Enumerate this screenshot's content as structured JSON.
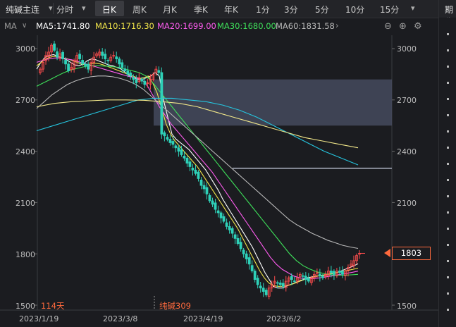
{
  "toolbar": {
    "title": "纯碱主连",
    "periods": [
      "分时",
      "日K",
      "周K",
      "月K",
      "季K",
      "年K",
      "1分",
      "3分",
      "5分",
      "10分",
      "15分"
    ],
    "active_period": "日K",
    "side_tab": "期货"
  },
  "ma": {
    "label": "MA",
    "ma5": "MA5:1741.80",
    "ma10": "MA10:1716.30",
    "ma20": "MA20:1699.00",
    "ma30": "MA30:1680.00",
    "ma60": "MA60:1831.58",
    "colors": {
      "ma5": "#ffffff",
      "ma10": "#f2e64a",
      "ma20": "#ff5cf0",
      "ma30": "#3ee05a",
      "ma60": "#b9b9b9",
      "long1": "#25c6e0",
      "long2": "#f2e88a"
    }
  },
  "y_ticks": [
    "3000",
    "2700",
    "2400",
    "2100",
    "1800",
    "1500"
  ],
  "x_ticks": [
    "2023/1/19",
    "2023/3/8",
    "2023/4/19",
    "2023/6/2"
  ],
  "current_price": "1803",
  "days_label": "114天",
  "contract_label": "纯碱309",
  "colors": {
    "up": "#ff4d4d",
    "down": "#2ed1b8",
    "accent": "#ff6a3d",
    "zone": "#4b5066"
  },
  "chart_data": {
    "type": "candlestick",
    "ylim": [
      1500,
      3000
    ],
    "y_ticks": [
      3000,
      2700,
      2400,
      2100,
      1800,
      1500
    ],
    "x_ticks": [
      "2023/1/19",
      "2023/3/8",
      "2023/4/19",
      "2023/6/2"
    ],
    "last_price": 1803,
    "highlight_zone": {
      "from": 2550,
      "to": 2820
    },
    "dashed_level": 2300,
    "ma": {
      "ma5": 1741.8,
      "ma10": 1716.3,
      "ma20": 1699.0,
      "ma30": 1680.0,
      "ma60": 1831.58
    },
    "candles_close": [
      2880,
      2920,
      2960,
      2980,
      3020,
      2990,
      2950,
      2970,
      2940,
      2910,
      2870,
      2890,
      2930,
      2960,
      2940,
      2910,
      2900,
      2880,
      2920,
      2950,
      2970,
      2980,
      2960,
      2940,
      2930,
      2950,
      2960,
      2940,
      2910,
      2890,
      2870,
      2850,
      2840,
      2820,
      2800,
      2830,
      2810,
      2790,
      2800,
      2820,
      2850,
      2880,
      2860,
      2500,
      2490,
      2470,
      2450,
      2440,
      2420,
      2400,
      2380,
      2360,
      2330,
      2310,
      2290,
      2270,
      2240,
      2200,
      2180,
      2150,
      2110,
      2090,
      2060,
      2040,
      2010,
      1990,
      1960,
      1940,
      1920,
      1890,
      1860,
      1830,
      1800,
      1770,
      1740,
      1700,
      1650,
      1620,
      1600,
      1580,
      1560,
      1600,
      1620,
      1640,
      1630,
      1620,
      1610,
      1640,
      1660,
      1650,
      1640,
      1660,
      1680,
      1670,
      1650,
      1640,
      1660,
      1680,
      1690,
      1670,
      1660,
      1680,
      1700,
      1690,
      1680,
      1700,
      1690,
      1680,
      1700,
      1720,
      1740,
      1760,
      1790,
      1803
    ],
    "series": [
      {
        "name": "MA5",
        "values": [
          2880,
          2920,
          2950,
          2960,
          2965,
          2955,
          2945,
          2935,
          2920,
          2905,
          2900,
          2910,
          2930,
          2940,
          2935,
          2925,
          2915,
          2905,
          2900,
          2890,
          2880,
          2860,
          2840,
          2830,
          2820,
          2820,
          2830,
          2840,
          2860,
          2840,
          2700,
          2600,
          2500,
          2470,
          2450,
          2430,
          2410,
          2380,
          2350,
          2320,
          2290,
          2250,
          2210,
          2170,
          2120,
          2080,
          2040,
          2000,
          1960,
          1920,
          1880,
          1840,
          1790,
          1740,
          1690,
          1650,
          1610,
          1600,
          1600,
          1610,
          1620,
          1630,
          1640,
          1650,
          1660,
          1665,
          1670,
          1672,
          1675,
          1680,
          1685,
          1690,
          1700,
          1710,
          1720,
          1730,
          1741.8
        ]
      },
      {
        "name": "MA10",
        "values": [
          2900,
          2920,
          2940,
          2950,
          2955,
          2950,
          2945,
          2940,
          2930,
          2920,
          2910,
          2905,
          2910,
          2915,
          2912,
          2905,
          2895,
          2885,
          2875,
          2865,
          2855,
          2845,
          2835,
          2825,
          2830,
          2840,
          2800,
          2740,
          2650,
          2560,
          2500,
          2460,
          2430,
          2400,
          2370,
          2340,
          2310,
          2270,
          2230,
          2190,
          2150,
          2110,
          2070,
          2030,
          1990,
          1950,
          1900,
          1850,
          1800,
          1750,
          1700,
          1660,
          1630,
          1615,
          1610,
          1610,
          1615,
          1620,
          1630,
          1640,
          1650,
          1658,
          1665,
          1670,
          1675,
          1680,
          1685,
          1690,
          1695,
          1700,
          1705,
          1710,
          1716.3
        ]
      },
      {
        "name": "MA20",
        "values": [
          2920,
          2930,
          2940,
          2945,
          2945,
          2940,
          2935,
          2925,
          2915,
          2905,
          2895,
          2885,
          2875,
          2865,
          2855,
          2845,
          2835,
          2830,
          2820,
          2780,
          2720,
          2660,
          2610,
          2560,
          2520,
          2480,
          2440,
          2400,
          2360,
          2320,
          2280,
          2230,
          2180,
          2130,
          2080,
          2030,
          1980,
          1930,
          1880,
          1830,
          1780,
          1740,
          1710,
          1690,
          1670,
          1660,
          1655,
          1655,
          1658,
          1662,
          1668,
          1674,
          1680,
          1686,
          1692,
          1699.0
        ]
      },
      {
        "name": "MA30",
        "values": [
          2780,
          2800,
          2820,
          2840,
          2860,
          2875,
          2885,
          2895,
          2900,
          2900,
          2898,
          2895,
          2890,
          2880,
          2870,
          2860,
          2840,
          2800,
          2750,
          2700,
          2650,
          2600,
          2550,
          2500,
          2450,
          2400,
          2350,
          2300,
          2250,
          2200,
          2150,
          2100,
          2050,
          2000,
          1950,
          1900,
          1850,
          1800,
          1760,
          1730,
          1710,
          1695,
          1685,
          1678,
          1675,
          1675,
          1677,
          1680.0
        ]
      },
      {
        "name": "MA60",
        "values": [
          2650,
          2690,
          2730,
          2760,
          2790,
          2810,
          2825,
          2835,
          2840,
          2840,
          2835,
          2825,
          2810,
          2790,
          2760,
          2720,
          2680,
          2640,
          2600,
          2560,
          2520,
          2480,
          2440,
          2400,
          2360,
          2320,
          2280,
          2240,
          2200,
          2160,
          2120,
          2080,
          2040,
          2000,
          1970,
          1945,
          1920,
          1900,
          1880,
          1865,
          1850,
          1840,
          1831.58
        ]
      },
      {
        "name": "",
        "values": [
          2520,
          2550,
          2580,
          2610,
          2640,
          2670,
          2700,
          2710,
          2710,
          2700,
          2690,
          2670,
          2640,
          2600,
          2550,
          2500,
          2450,
          2400,
          2360,
          2320
        ]
      },
      {
        "name": "",
        "values": [
          2660,
          2680,
          2690,
          2695,
          2700,
          2700,
          2698,
          2690,
          2680,
          2660,
          2630,
          2600,
          2570,
          2540,
          2510,
          2480,
          2460,
          2440,
          2420
        ]
      }
    ]
  }
}
